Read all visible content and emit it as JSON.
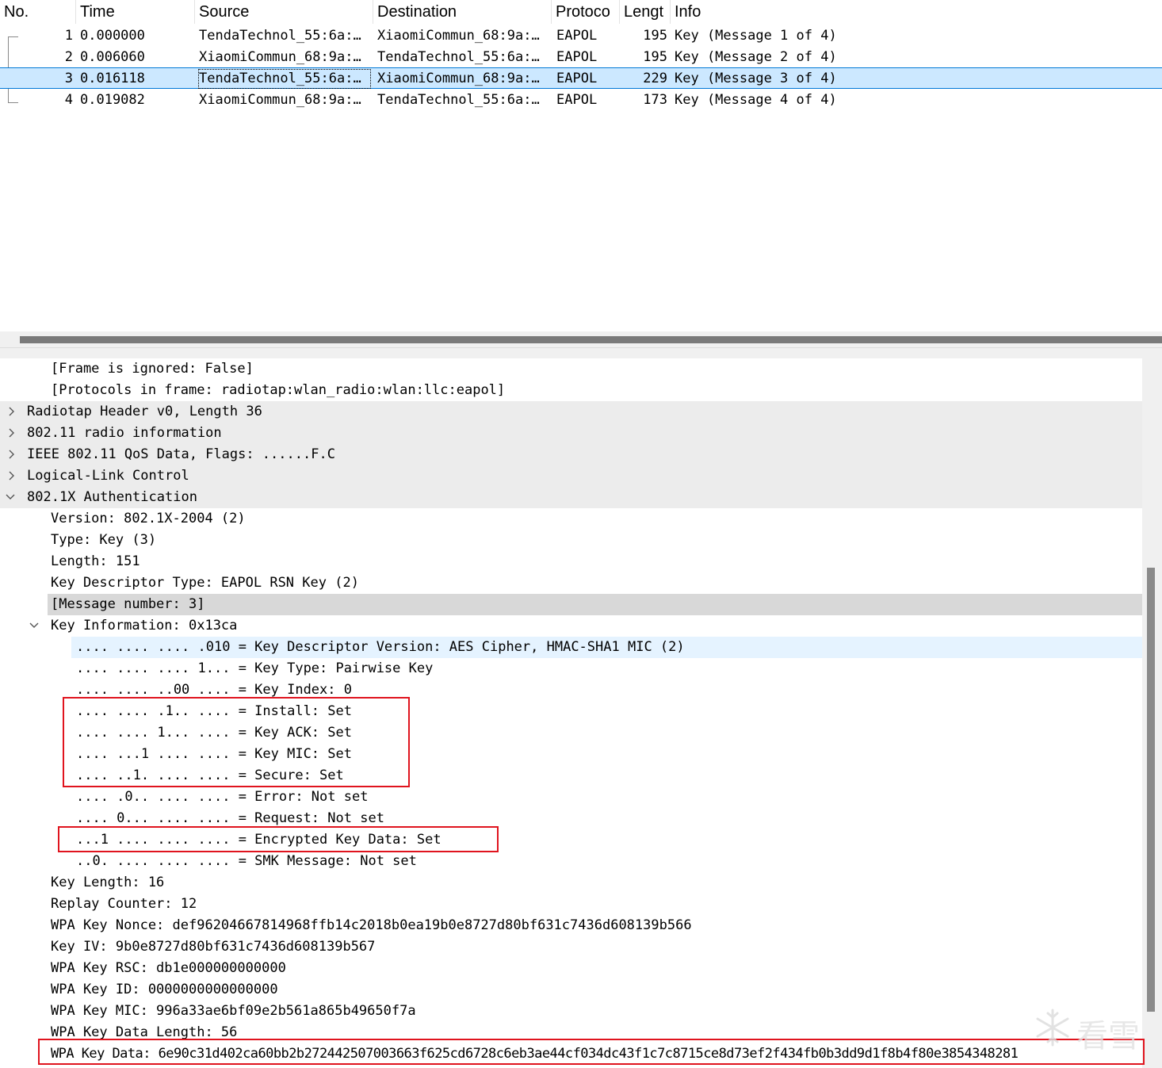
{
  "packet_list": {
    "columns": [
      "No.",
      "Time",
      "Source",
      "Destination",
      "Protoco",
      "Lengt",
      "Info"
    ],
    "rows": [
      {
        "no": "1",
        "time": "0.000000",
        "source": "TendaTechnol_55:6a:…",
        "destination": "XiaomiCommun_68:9a:…",
        "protocol": "EAPOL",
        "length": "195",
        "info": "Key (Message 1 of 4)"
      },
      {
        "no": "2",
        "time": "0.006060",
        "source": "XiaomiCommun_68:9a:…",
        "destination": "TendaTechnol_55:6a:…",
        "protocol": "EAPOL",
        "length": "195",
        "info": "Key (Message 2 of 4)"
      },
      {
        "no": "3",
        "time": "0.016118",
        "source": "TendaTechnol_55:6a:…",
        "destination": "XiaomiCommun_68:9a:…",
        "protocol": "EAPOL",
        "length": "229",
        "info": "Key (Message 3 of 4)"
      },
      {
        "no": "4",
        "time": "0.019082",
        "source": "XiaomiCommun_68:9a:…",
        "destination": "TendaTechnol_55:6a:…",
        "protocol": "EAPOL",
        "length": "173",
        "info": "Key (Message 4 of 4)"
      }
    ],
    "selected_row": "3"
  },
  "details": {
    "rows": [
      "[Frame is ignored: False]",
      "[Protocols in frame: radiotap:wlan_radio:wlan:llc:eapol]",
      "Radiotap Header v0, Length 36",
      "802.11 radio information",
      "IEEE 802.11 QoS Data, Flags: ......F.C",
      "Logical-Link Control",
      "802.1X Authentication",
      "Version: 802.1X-2004 (2)",
      "Type: Key (3)",
      "Length: 151",
      "Key Descriptor Type: EAPOL RSN Key (2)",
      "[Message number: 3]",
      "Key Information: 0x13ca",
      ".... .... .... .010 = Key Descriptor Version: AES Cipher, HMAC-SHA1 MIC (2)",
      ".... .... .... 1... = Key Type: Pairwise Key",
      ".... .... ..00 .... = Key Index: 0",
      ".... .... .1.. .... = Install: Set",
      ".... .... 1... .... = Key ACK: Set",
      ".... ...1 .... .... = Key MIC: Set",
      ".... ..1. .... .... = Secure: Set",
      ".... .0.. .... .... = Error: Not set",
      ".... 0... .... .... = Request: Not set",
      "...1 .... .... .... = Encrypted Key Data: Set",
      "..0. .... .... .... = SMK Message: Not set",
      "Key Length: 16",
      "Replay Counter: 12",
      "WPA Key Nonce: def96204667814968ffb14c2018b0ea19b0e8727d80bf631c7436d608139b566",
      "Key IV: 9b0e8727d80bf631c7436d608139b567",
      "WPA Key RSC: db1e000000000000",
      "WPA Key ID: 0000000000000000",
      "WPA Key MIC: 996a33ae6bf09e2b561a865b49650f7a",
      "WPA Key Data Length: 56",
      "WPA Key Data: 6e90c31d402ca60bb2b272442507003663f625cd6728c6eb3ae44cf034dc43f1c7c8715ce8d73ef2f434fb0b3dd9d1f8b4f80e3854348281"
    ]
  },
  "icons": {
    "collapsed": "chevron-right-icon",
    "expanded": "chevron-down-icon",
    "watermark": "snowflake-icon"
  },
  "watermark": {
    "text": "看雪"
  },
  "colors": {
    "selection": "#cce8ff",
    "selection_border": "#0078d7",
    "highlight": "#d8d8d8",
    "annotation": "#e0141e"
  }
}
